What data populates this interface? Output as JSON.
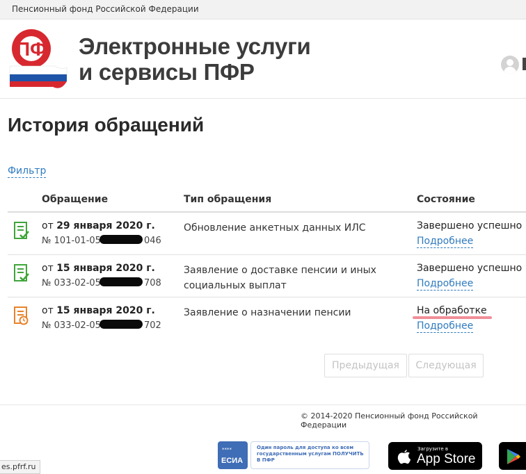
{
  "browser": {
    "tab_title": "Пенсионный фонд Российской Федерации",
    "status_url": "es.pfrf.ru"
  },
  "header": {
    "logo_text": "ПФ",
    "title_line1": "Электронные услуги",
    "title_line2": "и сервисы ПФР"
  },
  "page": {
    "title": "История обращений",
    "filter_label": "Фильтр"
  },
  "table": {
    "columns": [
      "Обращение",
      "Тип обращения",
      "Состояние"
    ],
    "rows": [
      {
        "date_prefix": "от",
        "date": "29 января 2020 г.",
        "number_start": "№ 101-01-05",
        "number_end": "046",
        "type": "Обновление анкетных данных ИЛС",
        "status": "Завершено успешно",
        "details": "Подробнее",
        "icon": "document-check-icon"
      },
      {
        "date_prefix": "от",
        "date": "15 января 2020 г.",
        "number_start": "№ 033-02-05",
        "number_end": "708",
        "type": "Заявление о доставке пенсии и иных социальных выплат",
        "status": "Завершено успешно",
        "details": "Подробнее",
        "icon": "document-check-icon"
      },
      {
        "date_prefix": "от",
        "date": "15 января 2020 г.",
        "number_start": "№ 033-02-05",
        "number_end": "702",
        "type": "Заявление о назначении пенсии",
        "status": "На обработке",
        "details": "Подробнее",
        "icon": "document-clock-icon"
      }
    ]
  },
  "pagination": {
    "prev_label": "Предыдущая",
    "next_label": "Следующая"
  },
  "footer": {
    "copyright": "© 2014-2020 Пенсионный фонд Российской Федерации",
    "esia_stars": "****",
    "esia_label": "ЕСИА",
    "esia_text": "Один пароль для доступа ко всем государственным услугам ПОЛУЧИТЬ В ПФР",
    "appstore_small": "Загрузите в",
    "appstore_big": "App Store"
  },
  "colors": {
    "link": "#2f7bbf",
    "success_icon": "#3fa53a",
    "pending_icon": "#e8832a",
    "logo_red": "#d7282f"
  }
}
